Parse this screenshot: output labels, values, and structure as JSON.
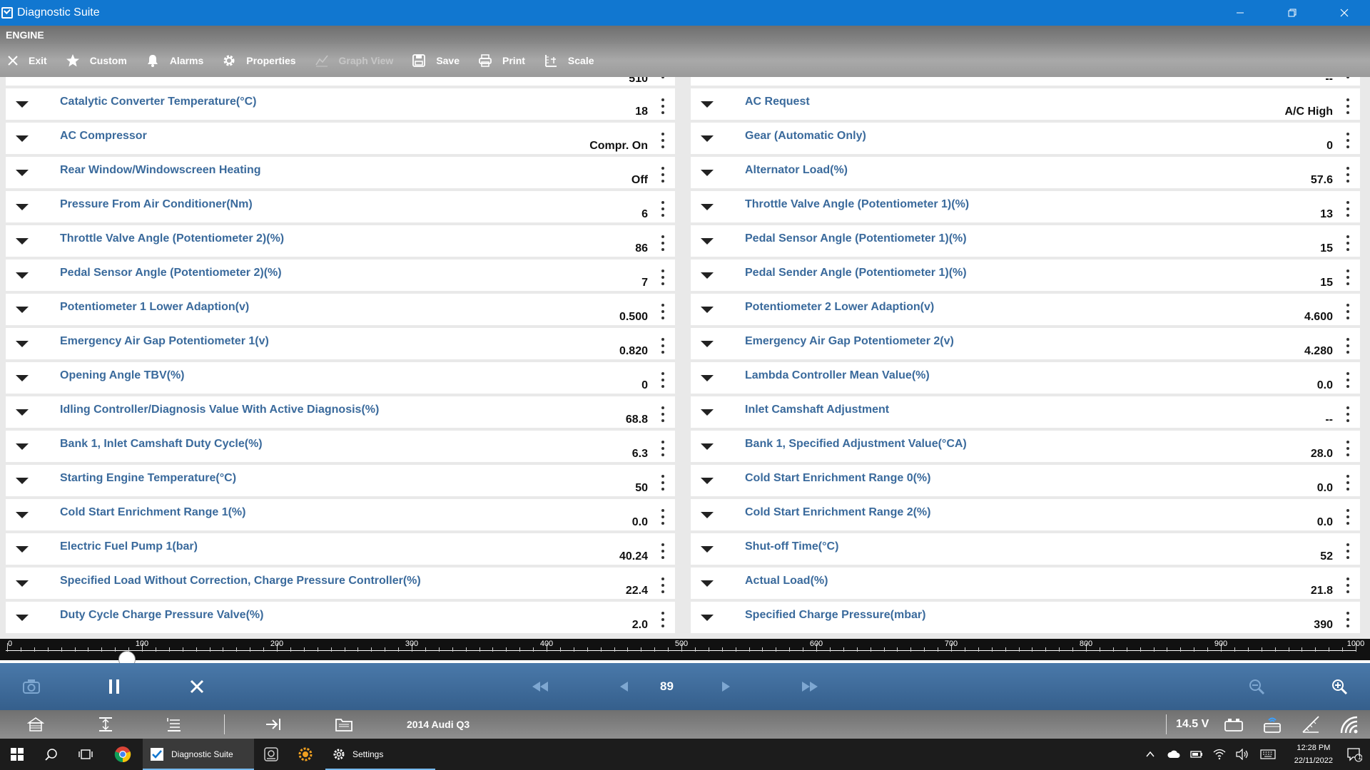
{
  "window": {
    "title": "Diagnostic Suite"
  },
  "module": {
    "name": "ENGINE"
  },
  "toolbar": {
    "exit": "Exit",
    "custom": "Custom",
    "alarms": "Alarms",
    "properties": "Properties",
    "graph_view": "Graph View",
    "save": "Save",
    "print": "Print",
    "scale": "Scale"
  },
  "left_partial_value": "510",
  "right_partial_value": "--",
  "left_rows": [
    {
      "label": "Catalytic Converter Temperature(°C)",
      "value": "18"
    },
    {
      "label": "AC Compressor",
      "value": "Compr. On"
    },
    {
      "label": "Rear Window/Windowscreen Heating",
      "value": "Off"
    },
    {
      "label": "Pressure From Air Conditioner(Nm)",
      "value": "6"
    },
    {
      "label": "Throttle Valve Angle (Potentiometer 2)(%)",
      "value": "86"
    },
    {
      "label": "Pedal Sensor Angle (Potentiometer 2)(%)",
      "value": "7"
    },
    {
      "label": "Potentiometer 1 Lower Adaption(v)",
      "value": "0.500"
    },
    {
      "label": "Emergency Air Gap Potentiometer 1(v)",
      "value": "0.820"
    },
    {
      "label": "Opening Angle TBV(%)",
      "value": "0"
    },
    {
      "label": "Idling Controller/Diagnosis Value With Active Diagnosis(%)",
      "value": "68.8"
    },
    {
      "label": "Bank 1, Inlet Camshaft Duty Cycle(%)",
      "value": "6.3"
    },
    {
      "label": "Starting Engine Temperature(°C)",
      "value": "50"
    },
    {
      "label": "Cold Start Enrichment Range 1(%)",
      "value": "0.0"
    },
    {
      "label": "Electric Fuel Pump 1(bar)",
      "value": "40.24"
    },
    {
      "label": "Specified Load Without Correction, Charge Pressure Controller(%)",
      "value": "22.4"
    },
    {
      "label": "Duty Cycle Charge Pressure Valve(%)",
      "value": "2.0"
    }
  ],
  "right_rows": [
    {
      "label": "AC Request",
      "value": "A/C High"
    },
    {
      "label": "Gear (Automatic Only)",
      "value": "0"
    },
    {
      "label": "Alternator Load(%)",
      "value": "57.6"
    },
    {
      "label": "Throttle Valve Angle (Potentiometer 1)(%)",
      "value": "13"
    },
    {
      "label": "Pedal Sensor Angle (Potentiometer 1)(%)",
      "value": "15"
    },
    {
      "label": "Pedal Sender Angle (Potentiometer 1)(%)",
      "value": "15"
    },
    {
      "label": "Potentiometer 2 Lower Adaption(v)",
      "value": "4.600"
    },
    {
      "label": "Emergency Air Gap Potentiometer 2(v)",
      "value": "4.280"
    },
    {
      "label": "Lambda Controller Mean Value(%)",
      "value": "0.0"
    },
    {
      "label": "Inlet Camshaft Adjustment",
      "value": "--"
    },
    {
      "label": "Bank 1, Specified Adjustment Value(°CA)",
      "value": "28.0"
    },
    {
      "label": "Cold Start Enrichment Range 0(%)",
      "value": "0.0"
    },
    {
      "label": "Cold Start Enrichment Range 2(%)",
      "value": "0.0"
    },
    {
      "label": "Shut-off Time(°C)",
      "value": "52"
    },
    {
      "label": "Actual Load(%)",
      "value": "21.8"
    },
    {
      "label": "Specified Charge Pressure(mbar)",
      "value": "390"
    }
  ],
  "timeline": {
    "min": 0,
    "max": 1000,
    "position": 89,
    "labels": [
      "0",
      "100",
      "200",
      "300",
      "400",
      "500",
      "600",
      "700",
      "800",
      "900",
      "1000"
    ]
  },
  "playback": {
    "page": "89"
  },
  "status": {
    "vehicle": "2014 Audi Q3",
    "voltage": "14.5 V"
  },
  "taskbar": {
    "app_diagnostic": "Diagnostic Suite",
    "app_settings": "Settings",
    "time": "12:28 PM",
    "date": "22/11/2022",
    "notification_count": "1"
  },
  "colors": {
    "titlebar": "#1177d0",
    "label": "#3a6a9c",
    "playback": "#4a79aa"
  }
}
